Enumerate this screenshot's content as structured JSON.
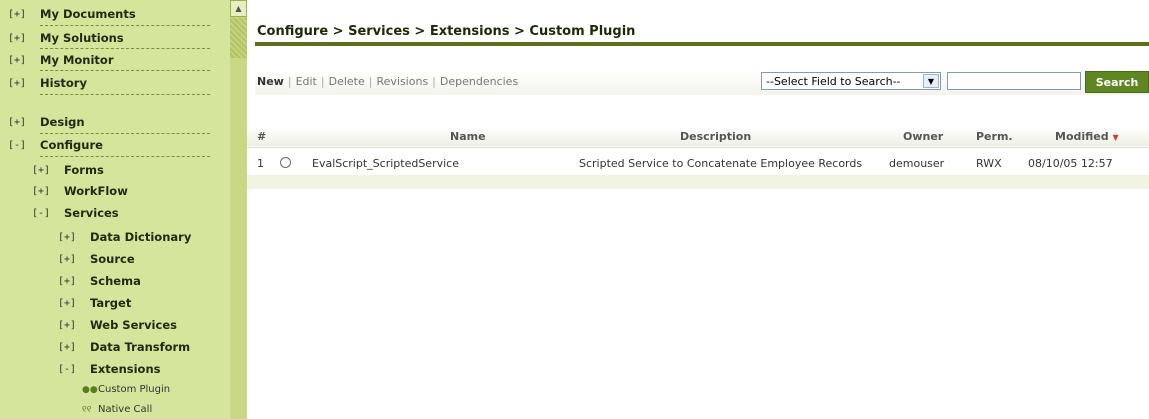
{
  "sidebar": {
    "top_items": [
      {
        "toggle": "[+]",
        "label": "My Documents"
      },
      {
        "toggle": "[+]",
        "label": "My Solutions"
      },
      {
        "toggle": "[+]",
        "label": "My Monitor"
      },
      {
        "toggle": "[+]",
        "label": "History"
      },
      {
        "toggle": "[+]",
        "label": "Design"
      },
      {
        "toggle": "[-]",
        "label": "Configure"
      }
    ],
    "configure_children": [
      {
        "toggle": "[+]",
        "label": "Forms"
      },
      {
        "toggle": "[+]",
        "label": "WorkFlow"
      },
      {
        "toggle": "[-]",
        "label": "Services"
      }
    ],
    "services_children": [
      {
        "toggle": "[+]",
        "label": "Data Dictionary"
      },
      {
        "toggle": "[+]",
        "label": "Source"
      },
      {
        "toggle": "[+]",
        "label": "Schema"
      },
      {
        "toggle": "[+]",
        "label": "Target"
      },
      {
        "toggle": "[+]",
        "label": "Web Services"
      },
      {
        "toggle": "[+]",
        "label": "Data Transform"
      },
      {
        "toggle": "[-]",
        "label": "Extensions"
      }
    ],
    "extension_items": [
      {
        "icon": "●●",
        "label": "Custom Plugin"
      },
      {
        "icon": "୧୧",
        "label": "Native Call"
      }
    ],
    "scroll_up_glyph": "▲"
  },
  "breadcrumb": "Configure > Services > Extensions > Custom Plugin",
  "actions": {
    "new": "New",
    "edit": "Edit",
    "delete": "Delete",
    "revisions": "Revisions",
    "dependencies": "Dependencies",
    "sep": "|"
  },
  "search": {
    "field_select_value": "--Select Field to Search--",
    "select_arrow": "▼",
    "input_value": "",
    "button_label": "Search"
  },
  "table": {
    "headers": {
      "num": "#",
      "name": "Name",
      "description": "Description",
      "owner": "Owner",
      "perm": "Perm.",
      "modified": "Modified",
      "sort_glyph": "▼"
    },
    "rows": [
      {
        "num": "1",
        "name": "EvalScript_ScriptedService",
        "description": "Scripted Service to Concatenate Employee Records",
        "owner": "demouser",
        "perm": "RWX",
        "modified": "08/10/05 12:57"
      }
    ]
  },
  "colors": {
    "sidebar_bg": "#d5e59c",
    "accent": "#5d6e1c",
    "search_button": "#5e8721",
    "sort_arrow": "#d0402a"
  }
}
